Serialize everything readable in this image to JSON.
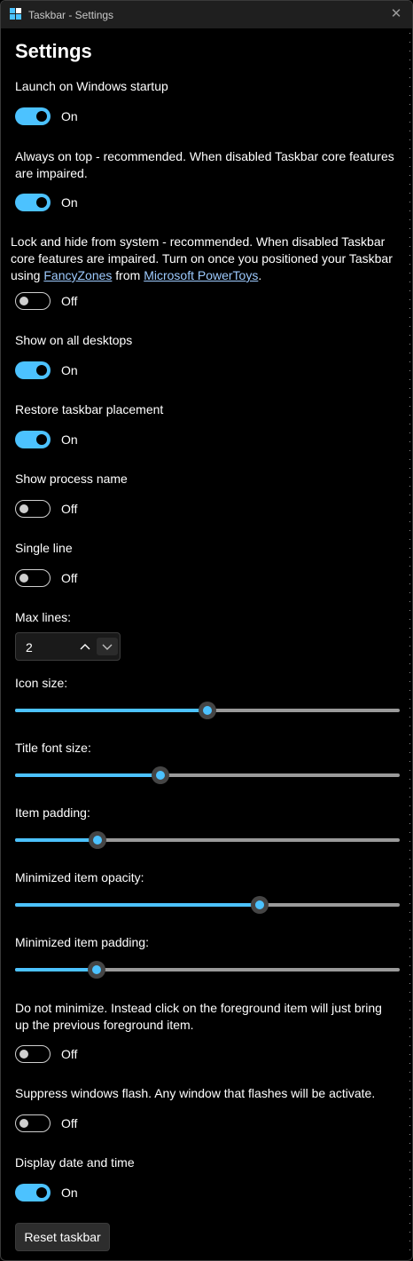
{
  "window": {
    "title": "Taskbar - Settings",
    "close_glyph": "✕"
  },
  "page": {
    "heading": "Settings"
  },
  "settings": [
    {
      "label": "Launch on Windows startup",
      "on": true,
      "state": "On"
    },
    {
      "label_line1": "Always on top - recommended. When disabled Taskbar core features",
      "label_line2": "are impaired.",
      "on": true,
      "state": "On"
    },
    {
      "label_line1": "Lock and hide from system - recommended. When disabled Taskbar",
      "label_line2": "core features are impaired. Turn on once you positioned your Taskbar",
      "label_line3_prefix": "using ",
      "link1": "FancyZones",
      "label_line3_middle": " from ",
      "link2": "Microsoft PowerToys",
      "label_line3_suffix": ".",
      "on": false,
      "state": "Off"
    },
    {
      "label": "Show on all desktops",
      "on": true,
      "state": "On"
    },
    {
      "label": "Restore taskbar placement",
      "on": true,
      "state": "On"
    },
    {
      "label": "Show process name",
      "on": false,
      "state": "Off"
    },
    {
      "label": "Single line",
      "on": false,
      "state": "Off"
    }
  ],
  "max_lines": {
    "label": "Max lines:",
    "value": "2",
    "up_icon": "chevron-up-icon",
    "down_icon": "chevron-down-icon"
  },
  "sliders": [
    {
      "label": "Icon size:",
      "level": 0.501
    },
    {
      "label": "Title font size:",
      "level": 0.379
    },
    {
      "label": "Item padding:",
      "level": 0.214
    },
    {
      "label": "Minimized item opacity:",
      "level": 0.635
    },
    {
      "label": "Minimized item padding:",
      "level": 0.212
    }
  ],
  "settings2": [
    {
      "label_line1": "Do not minimize. Instead click on the foreground item will just bring",
      "label_line2": "up the previous foreground item.",
      "on": false,
      "state": "Off"
    },
    {
      "label": "Suppress windows flash. Any window that flashes will be activate.",
      "on": false,
      "state": "Off"
    },
    {
      "label": "Display date and time",
      "on": true,
      "state": "On"
    }
  ],
  "reset_label": "Reset taskbar",
  "colors": {
    "accent": "#4cc2ff",
    "background": "#000000",
    "titlebar": "#1f1f1f"
  }
}
